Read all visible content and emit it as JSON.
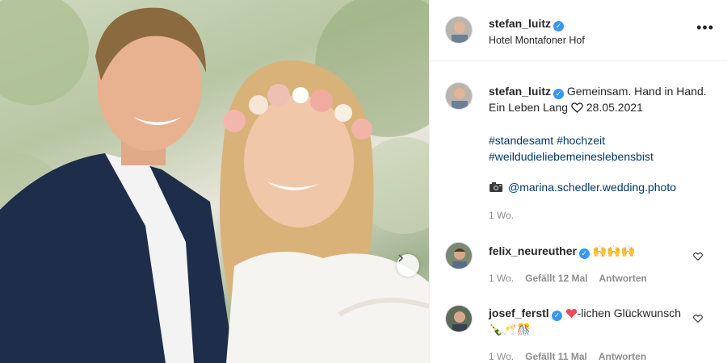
{
  "post": {
    "author": "stefan_luitz",
    "location": "Hotel Montafoner Hof",
    "more_icon": "more-horizontal-icon",
    "caption_author": "stefan_luitz",
    "caption_text": "Gemeinsam. Hand in Hand. Ein Leben Lang",
    "caption_date": "28.05.2021",
    "hashtag_1": "#standesamt",
    "hashtag_2": "#hochzeit",
    "hashtag_3": "#weildudieliebemeineslebensbist",
    "photo_credit": "@marina.schedler.wedding.photo",
    "time_ago": "1 Wo."
  },
  "comments": [
    {
      "author": "felix_neureuther",
      "text": "🙌🙌🙌",
      "time": "1 Wo.",
      "likes": "Gefällt 12 Mal",
      "reply": "Antworten"
    },
    {
      "author": "josef_ferstl",
      "text_before": "",
      "text_after": "-lichen Glückwunsch 🍾🥂🎊",
      "time": "1 Wo.",
      "likes": "Gefällt 11 Mal",
      "reply": "Antworten"
    }
  ],
  "colors": {
    "verified": "#3897f0",
    "link": "#00376b",
    "heart": "#ed4956",
    "secondary": "#8e8e8e"
  }
}
